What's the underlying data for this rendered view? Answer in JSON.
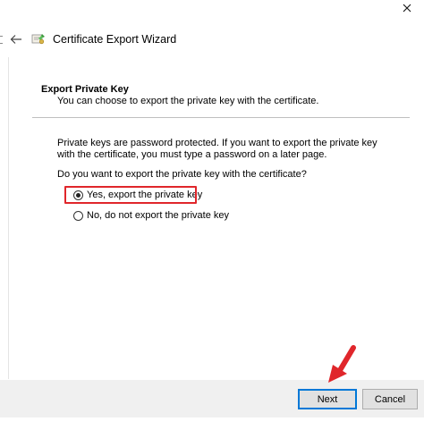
{
  "window": {
    "title": "Certificate Export Wizard"
  },
  "section": {
    "heading": "Export Private Key",
    "subheading": "You can choose to export the private key with the certificate."
  },
  "body": {
    "description": "Private keys are password protected. If you want to export the private key with the certificate, you must type a password on a later page.",
    "question": "Do you want to export the private key with the certificate?"
  },
  "options": {
    "yes_label": "Yes, export the private key",
    "no_label": "No, do not export the private key",
    "selected": "yes"
  },
  "buttons": {
    "next_label": "Next",
    "cancel_label": "Cancel"
  },
  "icons": {
    "close": "close-icon",
    "back": "back-arrow-icon",
    "wizard": "certificate-icon"
  },
  "colors": {
    "highlight": "#e0262b",
    "annotation_arrow": "#e0262b",
    "focus_border": "#0078d7",
    "footer_background": "#f0f0f0"
  }
}
